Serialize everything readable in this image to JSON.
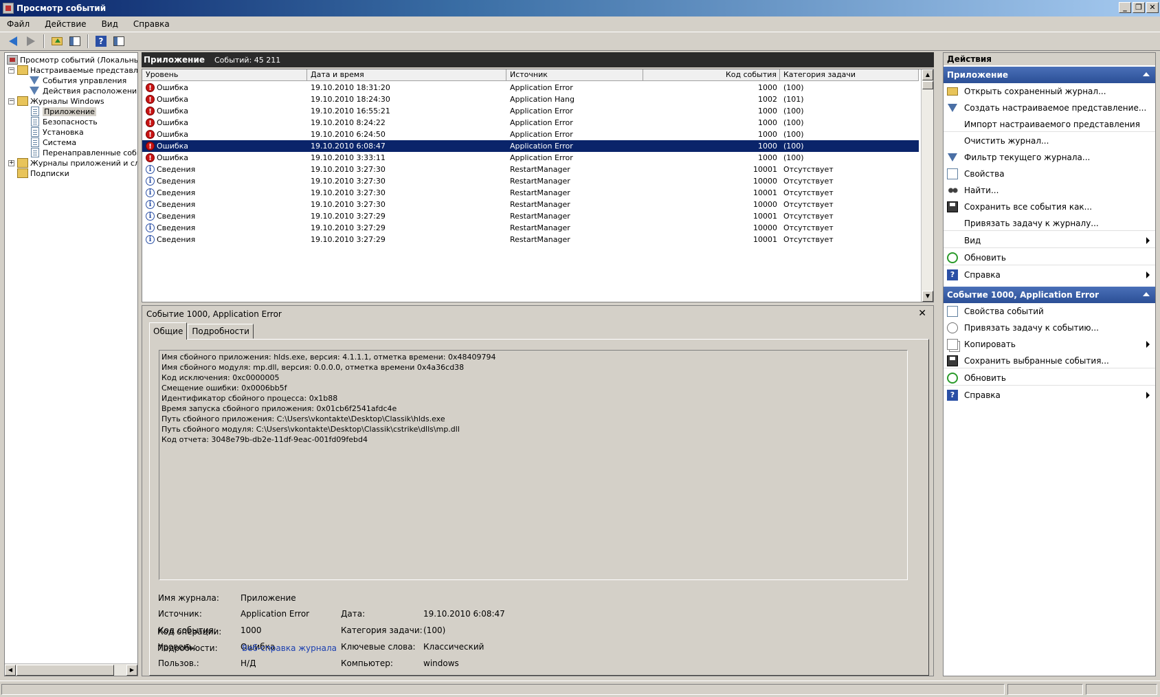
{
  "window": {
    "title": "Просмотр событий"
  },
  "menu": [
    "Файл",
    "Действие",
    "Вид",
    "Справка"
  ],
  "tree": {
    "root": "Просмотр событий (Локальный)",
    "custom_views": "Настраиваемые представления",
    "admin_events": "События управления",
    "location_actions": "Действия расположения",
    "windows_logs": "Журналы Windows",
    "application": "Приложение",
    "security": "Безопасность",
    "setup": "Установка",
    "system": "Система",
    "forwarded": "Перенаправленные события",
    "apps_services": "Журналы приложений и служб",
    "subscriptions": "Подписки"
  },
  "list": {
    "log_name": "Приложение",
    "count_label": "Событий: 45 211",
    "columns": [
      "Уровень",
      "Дата и время",
      "Источник",
      "Код события",
      "Категория задачи"
    ],
    "rows": [
      {
        "level": "Ошибка",
        "type": "error",
        "date": "19.10.2010 18:31:20",
        "source": "Application Error",
        "id": "1000",
        "cat": "(100)"
      },
      {
        "level": "Ошибка",
        "type": "error",
        "date": "19.10.2010 18:24:30",
        "source": "Application Hang",
        "id": "1002",
        "cat": "(101)"
      },
      {
        "level": "Ошибка",
        "type": "error",
        "date": "19.10.2010 16:55:21",
        "source": "Application Error",
        "id": "1000",
        "cat": "(100)"
      },
      {
        "level": "Ошибка",
        "type": "error",
        "date": "19.10.2010 8:24:22",
        "source": "Application Error",
        "id": "1000",
        "cat": "(100)"
      },
      {
        "level": "Ошибка",
        "type": "error",
        "date": "19.10.2010 6:24:50",
        "source": "Application Error",
        "id": "1000",
        "cat": "(100)"
      },
      {
        "level": "Ошибка",
        "type": "error",
        "date": "19.10.2010 6:08:47",
        "source": "Application Error",
        "id": "1000",
        "cat": "(100)",
        "selected": true
      },
      {
        "level": "Ошибка",
        "type": "error",
        "date": "19.10.2010 3:33:11",
        "source": "Application Error",
        "id": "1000",
        "cat": "(100)"
      },
      {
        "level": "Сведения",
        "type": "info",
        "date": "19.10.2010 3:27:30",
        "source": "RestartManager",
        "id": "10001",
        "cat": "Отсутствует"
      },
      {
        "level": "Сведения",
        "type": "info",
        "date": "19.10.2010 3:27:30",
        "source": "RestartManager",
        "id": "10000",
        "cat": "Отсутствует"
      },
      {
        "level": "Сведения",
        "type": "info",
        "date": "19.10.2010 3:27:30",
        "source": "RestartManager",
        "id": "10001",
        "cat": "Отсутствует"
      },
      {
        "level": "Сведения",
        "type": "info",
        "date": "19.10.2010 3:27:30",
        "source": "RestartManager",
        "id": "10000",
        "cat": "Отсутствует"
      },
      {
        "level": "Сведения",
        "type": "info",
        "date": "19.10.2010 3:27:29",
        "source": "RestartManager",
        "id": "10001",
        "cat": "Отсутствует"
      },
      {
        "level": "Сведения",
        "type": "info",
        "date": "19.10.2010 3:27:29",
        "source": "RestartManager",
        "id": "10000",
        "cat": "Отсутствует"
      },
      {
        "level": "Сведения",
        "type": "info",
        "date": "19.10.2010 3:27:29",
        "source": "RestartManager",
        "id": "10001",
        "cat": "Отсутствует"
      }
    ]
  },
  "detail": {
    "title": "Событие 1000, Application Error",
    "tab_general": "Общие",
    "tab_details": "Подробности",
    "description": [
      "Имя сбойного приложения: hlds.exe, версия: 4.1.1.1, отметка времени: 0x48409794",
      "Имя сбойного модуля: mp.dll, версия: 0.0.0.0, отметка времени 0x4a36cd38",
      "Код исключения: 0xc0000005",
      "Смещение ошибки: 0x0006bb5f",
      "Идентификатор сбойного процесса: 0x1b88",
      "Время запуска сбойного приложения: 0x01cb6f2541afdc4e",
      "Путь сбойного приложения: C:\\Users\\vkontakte\\Desktop\\Classik\\hlds.exe",
      "Путь сбойного модуля: C:\\Users\\vkontakte\\Desktop\\Classik\\cstrike\\dlls\\mp.dll",
      "Код отчета: 3048e79b-db2e-11df-9eac-001fd09febd4"
    ],
    "labels": {
      "log": "Имя журнала:",
      "source": "Источник:",
      "event_id": "Код события:",
      "level": "Уровень:",
      "user": "Пользов.:",
      "opcode": "Код операции:",
      "more": "Подробности:",
      "date": "Дата:",
      "task": "Категория задачи:",
      "keywords": "Ключевые слова:",
      "computer": "Компьютер:"
    },
    "values": {
      "log": "Приложение",
      "source": "Application Error",
      "event_id": "1000",
      "level": "Ошибка",
      "user": "Н/Д",
      "more_link": "Веб-справка журнала",
      "date": "19.10.2010 6:08:47",
      "task": "(100)",
      "keywords": "Классический",
      "computer": "windows"
    }
  },
  "actions": {
    "header": "Действия",
    "section1": "Приложение",
    "items1": [
      "Открыть сохраненный журнал...",
      "Создать настраиваемое представление...",
      "Импорт настраиваемого представления",
      "Очистить журнал...",
      "Фильтр текущего журнала...",
      "Свойства",
      "Найти...",
      "Сохранить все события как...",
      "Привязать задачу к журналу...",
      "Вид",
      "Обновить",
      "Справка"
    ],
    "section2": "Событие 1000, Application Error",
    "items2": [
      "Свойства событий",
      "Привязать задачу к событию...",
      "Копировать",
      "Сохранить выбранные события...",
      "Обновить",
      "Справка"
    ]
  },
  "colors": {
    "selection": "#0a246a",
    "section_header": "#2b4f96",
    "error": "#c81414",
    "link": "#1a3fb0"
  }
}
